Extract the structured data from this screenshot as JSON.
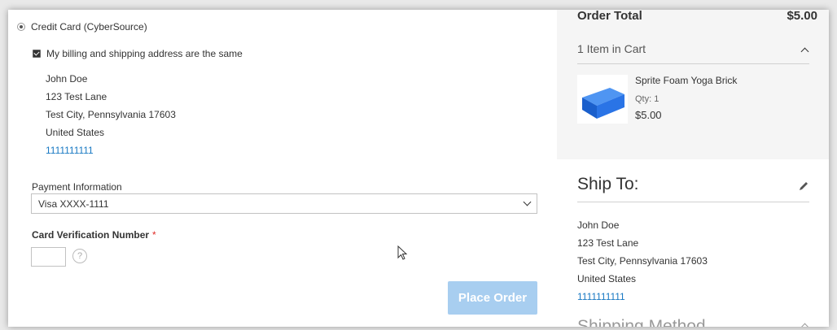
{
  "payment": {
    "method_label": "Credit Card (CyberSource)",
    "same_address_label": "My billing and shipping address are the same",
    "billing_address": {
      "name": "John Doe",
      "street": "123 Test Lane",
      "city_state_zip": "Test City, Pennsylvania 17603",
      "country": "United States",
      "phone": "1111111111"
    },
    "payment_info_label": "Payment Information",
    "selected_card": "Visa XXXX-1111",
    "cvn_label": "Card Verification Number",
    "required_marker": "*",
    "help_icon_glyph": "?",
    "place_order_label": "Place Order"
  },
  "summary": {
    "order_total_label": "Order Total",
    "order_total_value": "$5.00",
    "items_in_cart": "1 Item in Cart",
    "product": {
      "name": "Sprite Foam Yoga Brick",
      "qty": "Qty: 1",
      "price": "$5.00"
    }
  },
  "ship_to": {
    "title": "Ship To:",
    "name": "John Doe",
    "street": "123 Test Lane",
    "city_state_zip": "Test City, Pennsylvania 17603",
    "country": "United States",
    "phone": "1111111111"
  },
  "shipping_method": {
    "title": "Shipping Method"
  },
  "colors": {
    "link_blue": "#1979c3",
    "button_disabled": "#a8cef0",
    "required_red": "#e02b27",
    "summary_bg": "#f5f5f5",
    "product_blue": "#1e6fe0"
  }
}
